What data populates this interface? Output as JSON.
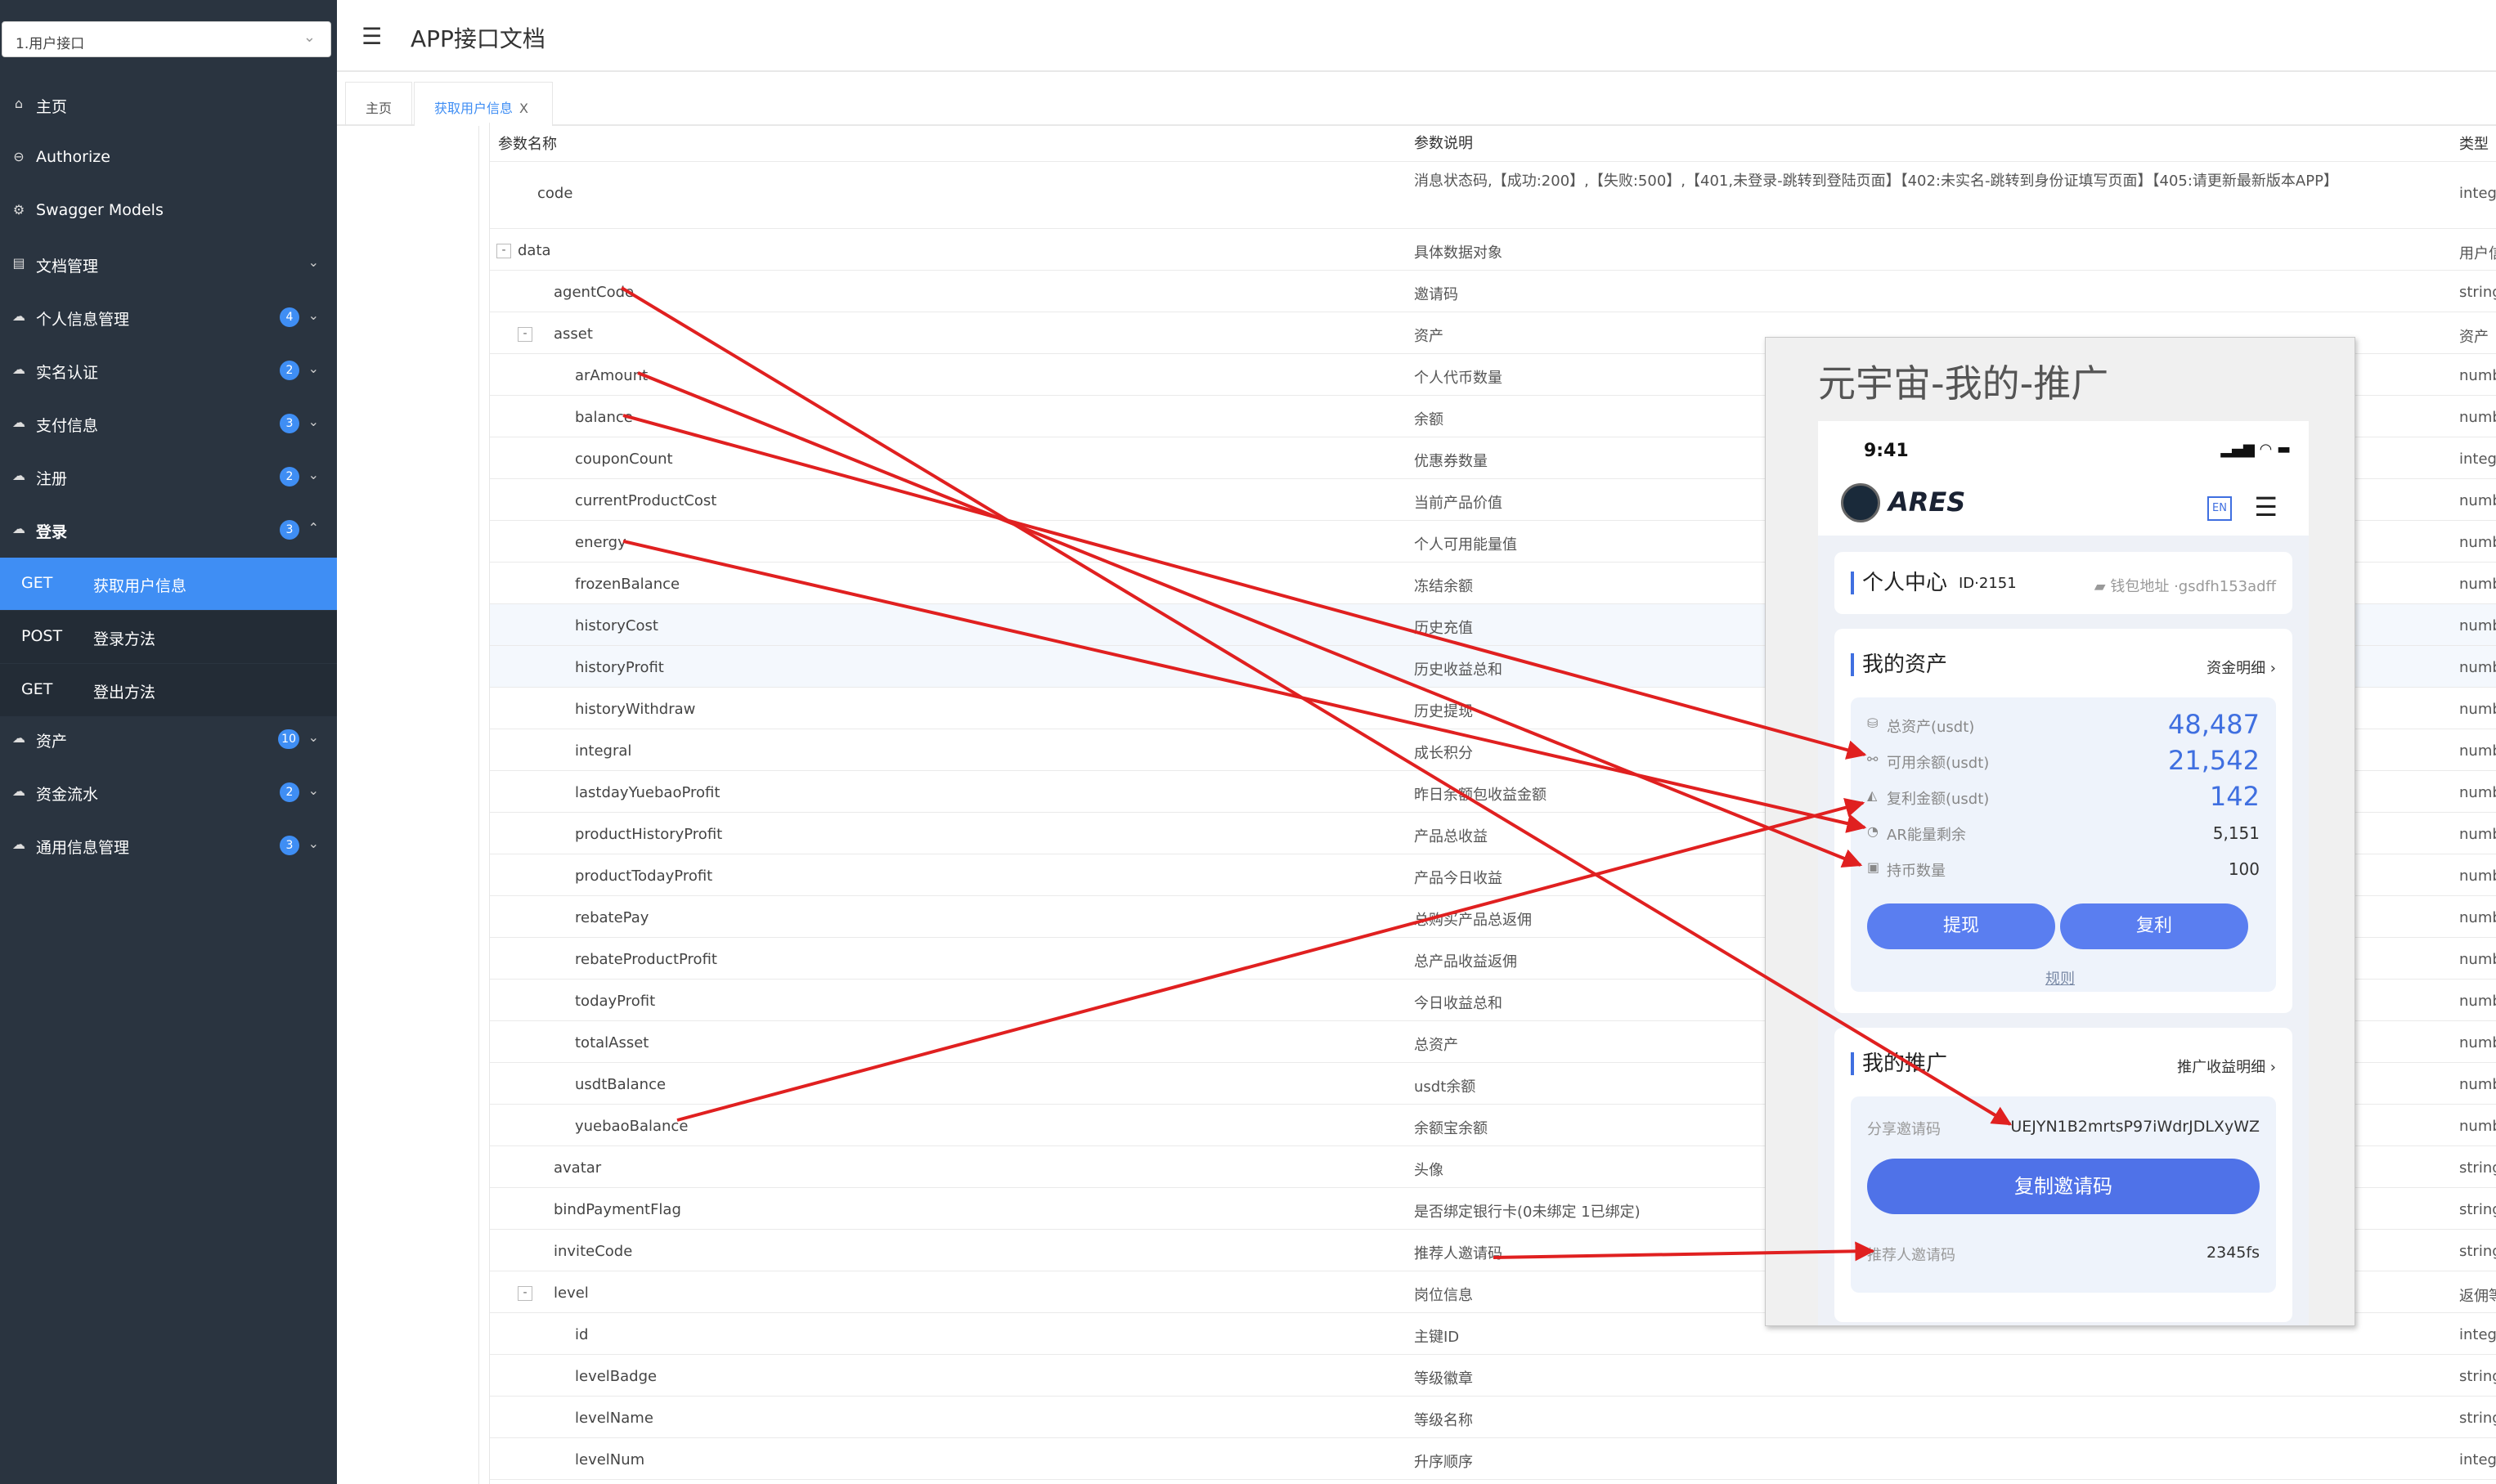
{
  "sidebar": {
    "select_value": "1.用户接口",
    "items": [
      {
        "label": "主页",
        "icon": "home-icon"
      },
      {
        "label": "Authorize",
        "icon": "lock-icon"
      },
      {
        "label": "Swagger Models",
        "icon": "gear-icon"
      },
      {
        "label": "文档管理",
        "icon": "doc-icon"
      },
      {
        "label": "个人信息管理",
        "badge": "4"
      },
      {
        "label": "实名认证",
        "badge": "2"
      },
      {
        "label": "支付信息",
        "badge": "3"
      },
      {
        "label": "注册",
        "badge": "2"
      },
      {
        "label": "登录",
        "badge": "3"
      },
      {
        "label": "资产",
        "badge": "10"
      },
      {
        "label": "资金流水",
        "badge": "2"
      },
      {
        "label": "通用信息管理",
        "badge": "3"
      }
    ],
    "sub": [
      {
        "method": "GET",
        "label": "获取用户信息"
      },
      {
        "method": "POST",
        "label": "登录方法"
      },
      {
        "method": "GET",
        "label": "登出方法"
      }
    ]
  },
  "header": {
    "title": "APP接口文档"
  },
  "tabs": {
    "home": "主页",
    "current": "获取用户信息",
    "close": "X"
  },
  "table": {
    "headers": {
      "name": "参数名称",
      "desc": "参数说明",
      "type": "类型"
    },
    "rows": [
      {
        "name": "code",
        "desc": "消息状态码,【成功:200】,【失败:500】,【401,未登录-跳转到登陆页面】【402:未实名-跳转到身份证填写页面】【405:请更新最新版本APP】",
        "type": "integer"
      },
      {
        "name": "data",
        "desc": "具体数据对象",
        "type": "用户信息"
      },
      {
        "name": "agentCode",
        "desc": "邀请码",
        "type": "string"
      },
      {
        "name": "asset",
        "desc": "资产",
        "type": "资产"
      },
      {
        "name": "arAmount",
        "desc": "个人代币数量",
        "type": "number"
      },
      {
        "name": "balance",
        "desc": "余额",
        "type": "number"
      },
      {
        "name": "couponCount",
        "desc": "优惠券数量",
        "type": "integer"
      },
      {
        "name": "currentProductCost",
        "desc": "当前产品价值",
        "type": "number"
      },
      {
        "name": "energy",
        "desc": "个人可用能量值",
        "type": "number"
      },
      {
        "name": "frozenBalance",
        "desc": "冻结余额",
        "type": "number"
      },
      {
        "name": "historyCost",
        "desc": "历史充值",
        "type": "number"
      },
      {
        "name": "historyProfit",
        "desc": "历史收益总和",
        "type": "number"
      },
      {
        "name": "historyWithdraw",
        "desc": "历史提现",
        "type": "number"
      },
      {
        "name": "integral",
        "desc": "成长积分",
        "type": "number"
      },
      {
        "name": "lastdayYuebaoProfit",
        "desc": "昨日余额包收益金额",
        "type": "number"
      },
      {
        "name": "productHistoryProfit",
        "desc": "产品总收益",
        "type": "number"
      },
      {
        "name": "productTodayProfit",
        "desc": "产品今日收益",
        "type": "number"
      },
      {
        "name": "rebatePay",
        "desc": "总购买产品总返佣",
        "type": "number"
      },
      {
        "name": "rebateProductProfit",
        "desc": "总产品收益返佣",
        "type": "number"
      },
      {
        "name": "todayProfit",
        "desc": "今日收益总和",
        "type": "number"
      },
      {
        "name": "totalAsset",
        "desc": "总资产",
        "type": "number"
      },
      {
        "name": "usdtBalance",
        "desc": "usdt余额",
        "type": "number"
      },
      {
        "name": "yuebaoBalance",
        "desc": "余额宝余额",
        "type": "number"
      },
      {
        "name": "avatar",
        "desc": "头像",
        "type": "string"
      },
      {
        "name": "bindPaymentFlag",
        "desc": "是否绑定银行卡(0未绑定 1已绑定)",
        "type": "string"
      },
      {
        "name": "inviteCode",
        "desc": "推荐人邀请码",
        "type": "string"
      },
      {
        "name": "level",
        "desc": "岗位信息",
        "type": "返佣等级"
      },
      {
        "name": "id",
        "desc": "主键ID",
        "type": "integer"
      },
      {
        "name": "levelBadge",
        "desc": "等级徽章",
        "type": "string"
      },
      {
        "name": "levelName",
        "desc": "等级名称",
        "type": "string"
      },
      {
        "name": "levelNum",
        "desc": "升序顺序",
        "type": "integer"
      }
    ]
  },
  "panel": {
    "title": "元宇宙-我的-推广",
    "time": "9:41",
    "brand": "ARES",
    "lang": "EN",
    "center": {
      "title": "个人中心",
      "id": "ID·2151",
      "wallet": "钱包地址 ·gsdfh153adff"
    },
    "assets": {
      "title": "我的资产",
      "link": "资金明细 ›",
      "rows": [
        {
          "label": "总资产(usdt)",
          "value": "48,487"
        },
        {
          "label": "可用余额(usdt)",
          "value": "21,542"
        },
        {
          "label": "复利金额(usdt)",
          "value": "142"
        },
        {
          "label": "AR能量剩余",
          "value": "5,151"
        },
        {
          "label": "持币数量",
          "value": "100"
        }
      ],
      "btn_withdraw": "提现",
      "btn_compound": "复利",
      "rule": "规则"
    },
    "promo": {
      "title": "我的推广",
      "link": "推广收益明细 ›",
      "share_label": "分享邀请码",
      "share_value": "UEJYN1B2mrtsP97iWdrJDLXyWZ",
      "copy_btn": "复制邀请码",
      "ref_label": "推荐人邀请码",
      "ref_value": "2345fs"
    }
  },
  "colors": {
    "accent": "#3f8ef4",
    "sidebar": "#2a3440",
    "arrow": "#e02020"
  }
}
